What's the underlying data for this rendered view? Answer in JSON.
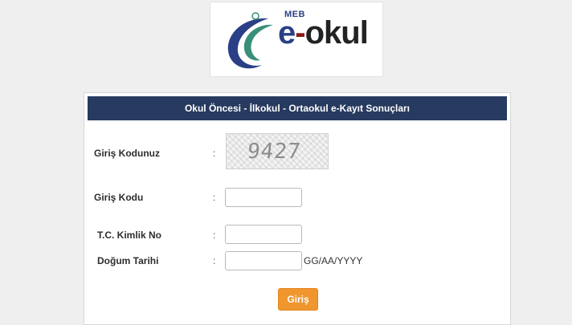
{
  "logo": {
    "org": "MEB",
    "name_e": "e",
    "name_dash": "-",
    "name_rest": "okul"
  },
  "form": {
    "title": "Okul Öncesi - İlkokul - Ortaokul e-Kayıt Sonuçları",
    "colon": ":",
    "captcha_label": "Giriş Kodunuz",
    "captcha_value": "9427",
    "code_label": "Giriş Kodu",
    "code_value": "",
    "tc_label": "T.C. Kimlik No",
    "tc_value": "",
    "birth_label": "Doğum Tarihi",
    "birth_value": "",
    "birth_hint": "GG/AA/YYYY",
    "submit_label": "Giriş"
  },
  "colors": {
    "header_bg": "#273a5f",
    "button_bg": "#f0962e",
    "logo_blue": "#2a3f86",
    "logo_green": "#3a8f7a"
  }
}
